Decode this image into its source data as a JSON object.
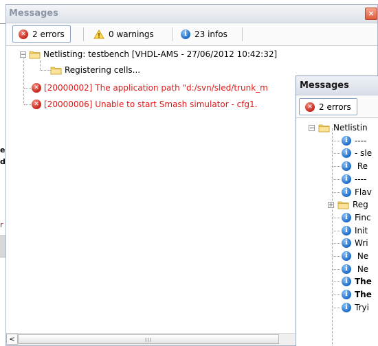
{
  "background_fragments": {
    "char1": "e",
    "char2": "d",
    "char3": "r"
  },
  "main": {
    "title": "Messages",
    "close_glyph": "×",
    "tabs": [
      {
        "label": "2 errors",
        "icon": "error-icon"
      },
      {
        "label": "0 warnings",
        "icon": "warning-icon"
      },
      {
        "label": "23 infos",
        "icon": "info-icon"
      }
    ],
    "tree": {
      "root": "Netlisting: testbench [VHDL-AMS - 27/06/2012 10:42:32]",
      "child": "Registering cells...",
      "errors": [
        "[20000002] The application path \"d:/svn/sled/trunk_m",
        "[20000006] Unable to start Smash simulator - cfg1."
      ]
    },
    "scrollbar": {
      "left_arrow": "<",
      "grip": "III"
    }
  },
  "overlay": {
    "title": "Messages",
    "tab_label": "2 errors",
    "rows": [
      {
        "text": "Netlistin",
        "icon": "folder",
        "bold": false
      },
      {
        "text": "----",
        "icon": "info",
        "bold": false
      },
      {
        "text": "- sle",
        "icon": "info",
        "bold": false
      },
      {
        "text": " Re",
        "icon": "info",
        "bold": false
      },
      {
        "text": "----",
        "icon": "info",
        "bold": false
      },
      {
        "text": "Flav",
        "icon": "info",
        "bold": false
      },
      {
        "text": "Reg",
        "icon": "folder",
        "bold": false
      },
      {
        "text": "Finc",
        "icon": "info",
        "bold": false
      },
      {
        "text": "Init",
        "icon": "info",
        "bold": false
      },
      {
        "text": "Wri",
        "icon": "info",
        "bold": false
      },
      {
        "text": " Ne",
        "icon": "info",
        "bold": false
      },
      {
        "text": " Ne",
        "icon": "info",
        "bold": false
      },
      {
        "text": "The",
        "icon": "info",
        "bold": true
      },
      {
        "text": "The",
        "icon": "info",
        "bold": true
      },
      {
        "text": "Tryi",
        "icon": "info",
        "bold": false
      }
    ]
  },
  "colors": {
    "error_text": "#e01818",
    "title_inactive": "#8c96a6",
    "info_blue": "#1d6cc8",
    "error_red": "#c9261c"
  }
}
